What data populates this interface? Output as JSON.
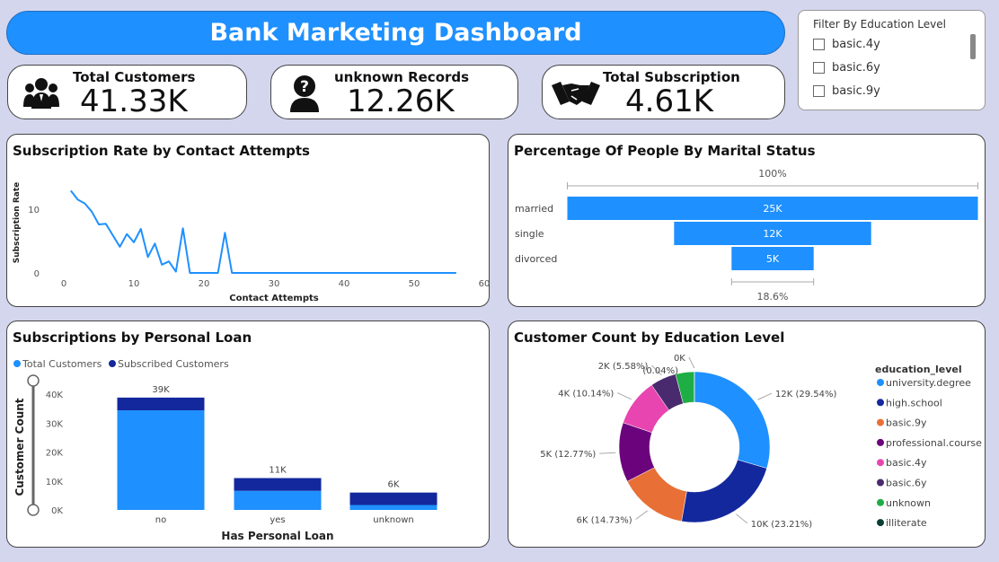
{
  "header": {
    "title": "Bank Marketing Dashboard"
  },
  "kpis": [
    {
      "label": "Total Customers",
      "value": "41.33K",
      "icon": "users-icon"
    },
    {
      "label": "unknown Records",
      "value": "12.26K",
      "icon": "question-person-icon"
    },
    {
      "label": "Total Subscription",
      "value": "4.61K",
      "icon": "handshake-icon"
    }
  ],
  "filter": {
    "title": "Filter By Education Level",
    "items": [
      "basic.4y",
      "basic.6y",
      "basic.9y"
    ]
  },
  "line_panel": {
    "title": "Subscription Rate by Contact Attempts"
  },
  "funnel_panel": {
    "title": "Percentage Of People By Marital Status"
  },
  "bar_panel": {
    "title": "Subscriptions by Personal Loan"
  },
  "donut_panel": {
    "title": "Customer Count by Education Level"
  },
  "chart_data": [
    {
      "type": "line",
      "title": "Subscription Rate by Contact Attempts",
      "xlabel": "Contact Attempts",
      "ylabel": "Subscription Rate",
      "xlim": [
        0,
        60
      ],
      "ylim": [
        -1,
        14
      ],
      "xticks": [
        "0",
        "10",
        "20",
        "30",
        "40",
        "50",
        "60"
      ],
      "yticks": [
        "0",
        "10"
      ],
      "color": "#1e90ff",
      "x": [
        1,
        2,
        3,
        4,
        5,
        6,
        7,
        8,
        9,
        10,
        11,
        12,
        13,
        14,
        15,
        16,
        17,
        18,
        19,
        20,
        21,
        22,
        23,
        24,
        25,
        26,
        27,
        28,
        29,
        30,
        31,
        32,
        33,
        34,
        35,
        37,
        39,
        40,
        41,
        42,
        43,
        56
      ],
      "y": [
        12.9,
        11.5,
        10.9,
        9.6,
        7.6,
        7.7,
        5.9,
        4.1,
        6.1,
        4.8,
        6.9,
        2.5,
        4.6,
        1.3,
        1.8,
        0.2,
        7.0,
        0,
        0,
        0,
        0,
        0,
        6.3,
        0,
        0,
        0,
        0,
        0,
        0,
        0,
        0,
        0,
        0,
        0,
        0,
        0,
        0,
        0,
        0,
        0,
        0,
        0
      ]
    },
    {
      "type": "bar",
      "title": "Percentage Of People By Marital Status",
      "categories": [
        "married",
        "single",
        "divorced"
      ],
      "values": [
        25,
        12,
        5
      ],
      "data_labels": [
        "25K",
        "12K",
        "5K"
      ],
      "top_label": "100%",
      "bottom_label": "18.6%",
      "color": "#1e90ff"
    },
    {
      "type": "bar",
      "title": "Subscriptions by Personal Loan",
      "xlabel": "Has Personal Loan",
      "ylabel": "Customer Count",
      "categories": [
        "no",
        "yes",
        "unknown"
      ],
      "series": [
        {
          "name": "Total Customers",
          "color": "#1e90ff",
          "values": [
            34.4,
            6.6,
            1.7
          ]
        },
        {
          "name": "Subscribed Customers",
          "color": "#13289c",
          "values": [
            4.4,
            4.4,
            4.3
          ]
        }
      ],
      "totals": [
        "39K",
        "11K",
        "6K"
      ],
      "yticks": [
        "0K",
        "10K",
        "20K",
        "30K",
        "40K"
      ],
      "ylim": [
        0,
        44
      ]
    },
    {
      "type": "pie",
      "title": "Customer Count by Education Level",
      "legend_title": "education_level",
      "legend_position": "right",
      "slices": [
        {
          "name": "university.degree",
          "value": 29.54,
          "label": "12K (29.54%)",
          "color": "#1e90ff"
        },
        {
          "name": "high.school",
          "value": 23.21,
          "label": "10K (23.21%)",
          "color": "#13289c"
        },
        {
          "name": "basic.9y",
          "value": 14.73,
          "label": "6K (14.73%)",
          "color": "#e86f36"
        },
        {
          "name": "professional.course",
          "value": 12.77,
          "label": "5K (12.77%)",
          "color": "#6b047c"
        },
        {
          "name": "basic.4y",
          "value": 10.14,
          "label": "4K (10.14%)",
          "color": "#e845b0"
        },
        {
          "name": "basic.6y",
          "value": 5.58,
          "label": "2K (5.58%)",
          "color": "#4a2a6e"
        },
        {
          "name": "unknown",
          "value": 3.99,
          "label": "",
          "color": "#1fae45"
        },
        {
          "name": "illiterate",
          "value": 0.04,
          "label": "0K",
          "color": "#0b3d34"
        }
      ],
      "extra_label": "(0.04%)"
    }
  ]
}
